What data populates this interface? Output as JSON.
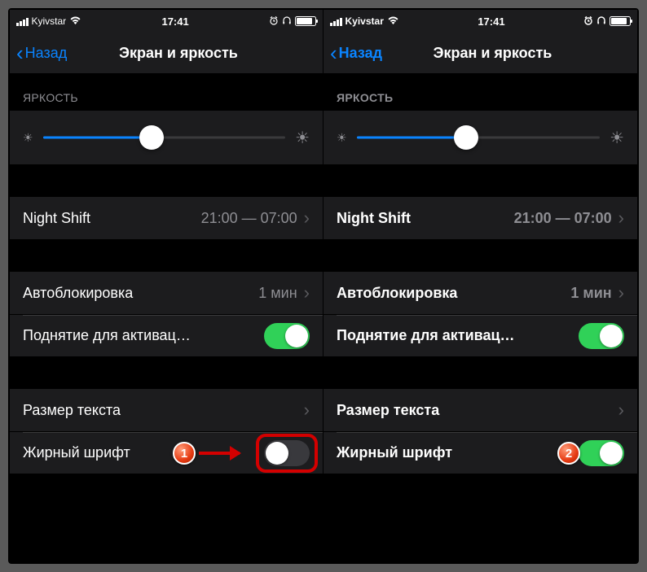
{
  "status": {
    "carrier": "Kyivstar",
    "time": "17:41"
  },
  "nav": {
    "back": "Назад",
    "title": "Экран и яркость"
  },
  "brightness": {
    "header": "ЯРКОСТЬ",
    "value_pct": 45
  },
  "nightshift": {
    "label": "Night Shift",
    "value": "21:00 — 07:00"
  },
  "autolock": {
    "label": "Автоблокировка",
    "value": "1 мин"
  },
  "raise": {
    "label": "Поднятие для активац…",
    "on": true
  },
  "textsize": {
    "label": "Размер текста"
  },
  "boldtext": {
    "label": "Жирный шрифт",
    "left_on": false,
    "right_on": true
  },
  "annotations": {
    "badge1": "1",
    "badge2": "2"
  }
}
